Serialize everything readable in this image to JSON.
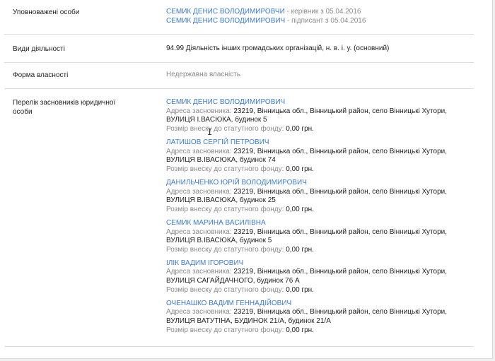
{
  "authorized": {
    "label": "Уповноважені особи",
    "persons": [
      {
        "name": "СЕМИК ДЕНИС ВОЛОДИМИРОВЧИ",
        "role": " - керівник з 05.04.2016"
      },
      {
        "name": "СЕМИК ДЕНИС ВОЛОДИМИРОВИЧ",
        "role": " - підписант з 05.04.2016"
      }
    ]
  },
  "activities": {
    "label": "Види діяльності",
    "value": "94.99 Діяльність інших громадських організацій, н. в. і. у. (основний)"
  },
  "ownership": {
    "label": "Форма власності",
    "value": "Недержавна власність"
  },
  "founders": {
    "label_line1": "Перелік засновників юридичної",
    "label_line2": "особи",
    "address_label": "Адреса засновника: ",
    "contribution_label": "Розмір внеску до статутного фонду: ",
    "items": [
      {
        "name": "СЕМИК ДЕНИС ВОЛОДИМИРОВИЧ",
        "address_line1": "23219, Вінницька обл., Вінницький район, село Вінницькі Хутори,",
        "address_line2": "ВУЛИЦЯ І.ВАСЮКА, будинок 5",
        "contribution": "0,00 грн."
      },
      {
        "name": "ЛАТИШОВ СЕРГІЙ ПЕТРОВИЧ",
        "address_line1": "23219, Вінницька обл., Вінницький район, село Вінницькі Хутори,",
        "address_line2": "ВУЛИЦЯ В.ІВАСЮКА, будинок 74",
        "contribution": "0,00 грн."
      },
      {
        "name": "ДАНИЛЬЧЕНКО ЮРІЙ ВОЛОДИМИРОВИЧ",
        "address_line1": "23219, Вінницька обл., Вінницький район, село Вінницькі Хутори,",
        "address_line2": "ВУЛИЦЯ В.ІВАСЮКА, будинок 25",
        "contribution": "0,00 грн."
      },
      {
        "name": "СЕМИК МАРИНА ВАСИЛІВНА",
        "address_line1": "23219, Вінницька обл., Вінницький район, село Вінницькі Хутори,",
        "address_line2": "ВУЛИЦЯ В.ІВАСЮКА, будинок 5",
        "contribution": "0,00 грн."
      },
      {
        "name": "ІЛІК ВАДИМ ІГОРОВИЧ",
        "address_line1": "23219, Вінницька обл., Вінницький район, село Вінницькі Хутори,",
        "address_line2": "ВУЛИЦЯ САГАЙДАЧНОГО, будинок 76 А",
        "contribution": "0,00 грн."
      },
      {
        "name": "ОЧЕНАШКО ВАДИМ ГЕННАДІЙОВИЧ",
        "address_line1": "23219, Вінницька обл., Вінницький район, село Вінницькі Хутори,",
        "address_line2": "ВУЛИЦЯ ВАТУТІНА, БУДИНОК 21/А, будинок 21/А",
        "contribution": "0,00 грн."
      }
    ]
  },
  "colors": {
    "link": "#3a7bd5",
    "muted": "#8a8a8a",
    "text": "#222222",
    "separator": "#dcdcdc"
  }
}
